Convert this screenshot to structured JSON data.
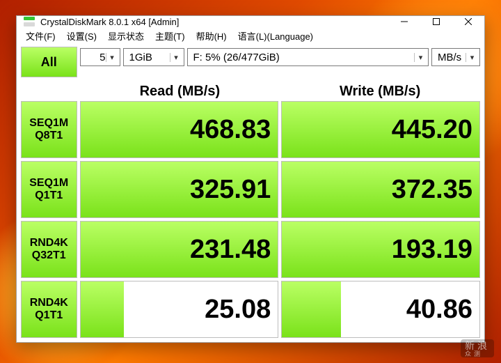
{
  "window": {
    "title": "CrystalDiskMark 8.0.1 x64 [Admin]"
  },
  "menu": {
    "file": "文件(F)",
    "settings": "设置(S)",
    "display_state": "显示状态",
    "theme": "主题(T)",
    "help": "帮助(H)",
    "language": "语言(L)(Language)"
  },
  "controls": {
    "all_label": "All",
    "count": "5",
    "test_size": "1GiB",
    "drive": "F: 5% (26/477GiB)",
    "unit": "MB/s"
  },
  "headers": {
    "read": "Read (MB/s)",
    "write": "Write (MB/s)"
  },
  "rows": [
    {
      "label1": "SEQ1M",
      "label2": "Q8T1",
      "read": "468.83",
      "write": "445.20",
      "read_fill": 100,
      "write_fill": 100
    },
    {
      "label1": "SEQ1M",
      "label2": "Q1T1",
      "read": "325.91",
      "write": "372.35",
      "read_fill": 100,
      "write_fill": 100
    },
    {
      "label1": "RND4K",
      "label2": "Q32T1",
      "read": "231.48",
      "write": "193.19",
      "read_fill": 100,
      "write_fill": 100
    },
    {
      "label1": "RND4K",
      "label2": "Q1T1",
      "read": "25.08",
      "write": "40.86",
      "read_fill": 22,
      "write_fill": 30
    }
  ],
  "watermark": {
    "line1": "新浪",
    "line2": "众测"
  }
}
